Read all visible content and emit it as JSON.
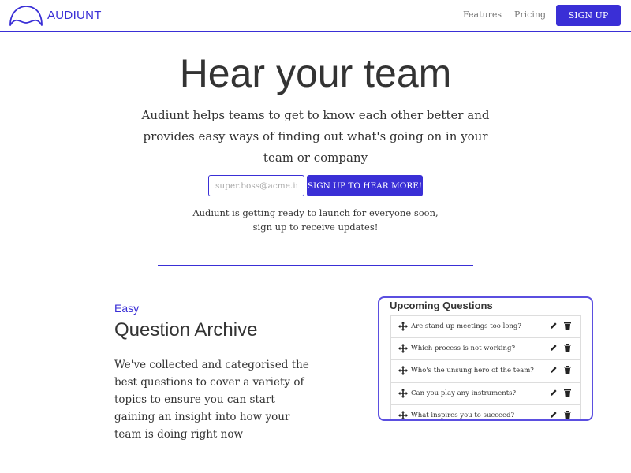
{
  "header": {
    "brand": "AUDIUNT",
    "nav": [
      {
        "label": "Features"
      },
      {
        "label": "Pricing"
      }
    ],
    "signup_label": "SIGN UP"
  },
  "hero": {
    "title": "Hear your team",
    "subtitle": "Audiunt helps teams to get to know each other better and provides easy ways of finding out what's going on in your team or company",
    "email_placeholder": "super.boss@acme.inc",
    "cta_label": "SIGN UP TO HEAR MORE!",
    "launch_note_line1": "Audiunt is getting ready to launch for everyone soon,",
    "launch_note_line2": "sign up to receive updates!"
  },
  "feature": {
    "tag": "Easy",
    "title": "Question Archive",
    "description": "We've collected and categorised the best questions to cover a variety of topics to ensure you can start gaining an insight into how your team is doing right now"
  },
  "upcoming": {
    "title": "Upcoming Questions",
    "questions": [
      "Are stand up meetings too long?",
      "Which process is not working?",
      "Who's the unsung hero of the team?",
      "Can you play any instruments?",
      "What inspires you to succeed?"
    ]
  },
  "colors": {
    "accent": "#3a2fd6",
    "text": "#333333",
    "muted": "#777777"
  },
  "icons": [
    "logo-arc-icon",
    "drag-move-icon",
    "pencil-icon",
    "trash-icon"
  ]
}
